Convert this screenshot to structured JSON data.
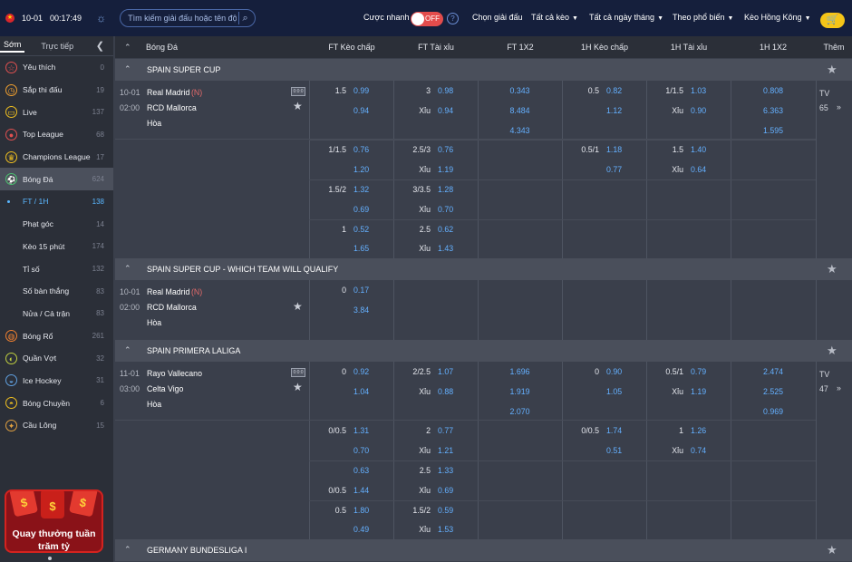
{
  "topbar": {
    "date": "10-01",
    "time": "00:17:49",
    "search_placeholder": "Tìm kiếm giải đấu hoặc tên đội",
    "quick_label": "Cược nhanh",
    "toggle_label": "OFF",
    "menus": [
      "Chọn giải đấu",
      "Tất cả kèo",
      "Tất cả ngày tháng",
      "Theo phổ biến",
      "Kèo Hồng Kông"
    ]
  },
  "sidebar": {
    "tab_early": "Sớm",
    "tab_live": "Trực tiếp",
    "items": [
      {
        "label": "Yêu thích",
        "count": "0",
        "icon": "star-icon",
        "color": "#e05050"
      },
      {
        "label": "Sắp thi đấu",
        "count": "19",
        "icon": "clock-icon",
        "color": "#f0a030"
      },
      {
        "label": "Live",
        "count": "137",
        "icon": "tv-icon",
        "color": "#f0c020"
      },
      {
        "label": "Top League",
        "count": "68",
        "icon": "medal-icon",
        "color": "#e05050"
      },
      {
        "label": "Champions League",
        "count": "17",
        "icon": "crown-icon",
        "color": "#f0c020"
      },
      {
        "label": "Bóng Đá",
        "count": "624",
        "icon": "soccer-ball-icon",
        "color": "#4cc070"
      },
      {
        "label": "FT / 1H",
        "count": "138"
      },
      {
        "label": "Phạt góc",
        "count": "14"
      },
      {
        "label": "Kèo 15 phút",
        "count": "174"
      },
      {
        "label": "Tỉ số",
        "count": "132"
      },
      {
        "label": "Số bàn thắng",
        "count": "83"
      },
      {
        "label": "Nửa / Cả trận",
        "count": "83"
      },
      {
        "label": "Bóng Rổ",
        "count": "261",
        "icon": "basketball-icon",
        "color": "#f08030"
      },
      {
        "label": "Quần Vợt",
        "count": "32",
        "icon": "tennis-icon",
        "color": "#c0d040"
      },
      {
        "label": "Ice Hockey",
        "count": "31",
        "icon": "hockey-icon",
        "color": "#60a0e0"
      },
      {
        "label": "Bóng Chuyền",
        "count": "6",
        "icon": "volleyball-icon",
        "color": "#f0c020"
      },
      {
        "label": "Cầu Lông",
        "count": "15",
        "icon": "badminton-icon",
        "color": "#e0a040"
      }
    ],
    "promo_line1": "Quay thưởng tuần",
    "promo_line2": "trăm tỷ"
  },
  "header": {
    "sport": "Bóng Đá",
    "cols": [
      "FT Kèo chấp",
      "FT Tài xỉu",
      "FT 1X2",
      "1H Kèo chấp",
      "1H Tài xỉu",
      "1H 1X2"
    ],
    "more": "Thêm"
  },
  "sections": [
    {
      "name": "SPAIN SUPER CUP"
    },
    {
      "name": "SPAIN SUPER CUP - WHICH TEAM WILL QUALIFY"
    },
    {
      "name": "SPAIN PRIMERA LALIGA"
    },
    {
      "name": "GERMANY BUNDESLIGA I"
    }
  ],
  "match1": {
    "date": "10-01",
    "time": "02:00",
    "home": "Real Madrid",
    "neutral": "(N)",
    "away": "RCD Mallorca",
    "draw": "Hòa",
    "tv": "TV",
    "more": "65",
    "live_badge": "0:0:0"
  },
  "match2": {
    "date": "10-01",
    "time": "02:00",
    "home": "Real Madrid",
    "neutral": "(N)",
    "away": "RCD Mallorca",
    "draw": "Hòa"
  },
  "match3": {
    "date": "11-01",
    "time": "03:00",
    "home": "Rayo Vallecano",
    "away": "Celta Vigo",
    "draw": "Hòa",
    "tv": "TV",
    "more": "47",
    "live_badge": "0:0:0"
  },
  "odds1": [
    [
      "1.5",
      "0.99",
      "3",
      "0.98",
      "0.343",
      "0.5",
      "0.82",
      "1/1.5",
      "1.03",
      "0.808"
    ],
    [
      "",
      "0.94",
      "Xỉu",
      "0.94",
      "8.484",
      "",
      "1.12",
      "Xỉu",
      "0.90",
      "6.363"
    ],
    [
      "",
      "",
      "",
      "",
      "4.343",
      "",
      "",
      "",
      "",
      "1.595"
    ],
    [
      "1/1.5",
      "0.76",
      "2.5/3",
      "0.76",
      "",
      "0.5/1",
      "1.18",
      "1.5",
      "1.40",
      ""
    ],
    [
      "",
      "1.20",
      "Xỉu",
      "1.19",
      "",
      "",
      "0.77",
      "Xỉu",
      "0.64",
      ""
    ],
    [
      "1.5/2",
      "1.32",
      "3/3.5",
      "1.28",
      "",
      "",
      "",
      "",
      "",
      ""
    ],
    [
      "",
      "0.69",
      "Xỉu",
      "0.70",
      "",
      "",
      "",
      "",
      "",
      ""
    ],
    [
      "1",
      "0.52",
      "2.5",
      "0.62",
      "",
      "",
      "",
      "",
      "",
      ""
    ],
    [
      "",
      "1.65",
      "Xỉu",
      "1.43",
      "",
      "",
      "",
      "",
      "",
      ""
    ]
  ],
  "odds2": [
    [
      "0",
      "0.17"
    ],
    [
      "",
      "3.84"
    ]
  ],
  "odds3": [
    [
      "0",
      "0.92",
      "2/2.5",
      "1.07",
      "1.696",
      "0",
      "0.90",
      "0.5/1",
      "0.79",
      "2.474"
    ],
    [
      "",
      "1.04",
      "Xỉu",
      "0.88",
      "1.919",
      "",
      "1.05",
      "Xỉu",
      "1.19",
      "2.525"
    ],
    [
      "",
      "",
      "",
      "",
      "2.070",
      "",
      "",
      "",
      "",
      "0.969"
    ],
    [
      "0/0.5",
      "1.31",
      "2",
      "0.77",
      "",
      "0/0.5",
      "1.74",
      "1",
      "1.26",
      ""
    ],
    [
      "",
      "0.70",
      "Xỉu",
      "1.21",
      "",
      "",
      "0.51",
      "Xỉu",
      "0.74",
      ""
    ],
    [
      "",
      "0.63",
      "2.5",
      "1.33",
      "",
      "",
      "",
      "",
      "",
      ""
    ],
    [
      "0/0.5",
      "1.44",
      "Xỉu",
      "0.69",
      "",
      "",
      "",
      "",
      "",
      ""
    ],
    [
      "0.5",
      "1.80",
      "1.5/2",
      "0.59",
      "",
      "",
      "",
      "",
      "",
      ""
    ],
    [
      "",
      "0.49",
      "Xỉu",
      "1.53",
      "",
      "",
      "",
      "",
      "",
      ""
    ]
  ],
  "colors": {
    "topbar": "#151f3c",
    "odds": "#64b0ff",
    "accent": "#f5c518",
    "promo": "#8a1218"
  }
}
